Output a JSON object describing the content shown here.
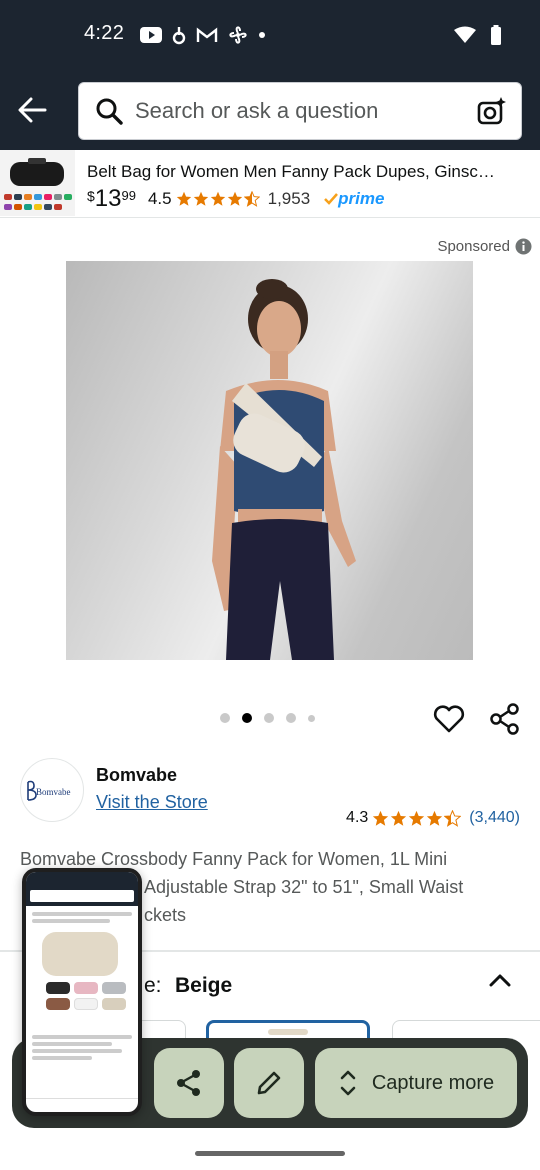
{
  "status_bar": {
    "time": "4:22"
  },
  "search": {
    "placeholder": "Search or ask a question"
  },
  "sticky_product": {
    "title": "Belt Bag for Women Men Fanny Pack Dupes, Ginsc…",
    "price_symbol": "$",
    "price_whole": "13",
    "price_fraction": "99",
    "rating": "4.5",
    "review_count": "1,953",
    "prime_label": "prime"
  },
  "sponsored_label": "Sponsored",
  "image_carousel": {
    "dot_count": 5,
    "active_index": 1
  },
  "brand": {
    "logo_text": "Bomvabe",
    "name": "Bomvabe",
    "visit_store_label": "Visit the Store",
    "rating": "4.3",
    "review_count": "(3,440)"
  },
  "product_title": {
    "line1": "Bomvabe Crossbody Fanny Pack for Women, 1L Mini",
    "line2": "Adjustable Strap 32\" to 51\", Small Waist",
    "line3": "ckets"
  },
  "color_selector": {
    "label_fragment": "e:",
    "value": "Beige"
  },
  "screenshot_toolbar": {
    "capture_more_label": "Capture more"
  },
  "colors": {
    "header_bg": "#1c2530",
    "link": "#2162a1",
    "star": "#e67a00",
    "prime": "#1a98ff",
    "toolbar_bg": "#2e3430",
    "toolbar_button": "#c7d3bb"
  }
}
